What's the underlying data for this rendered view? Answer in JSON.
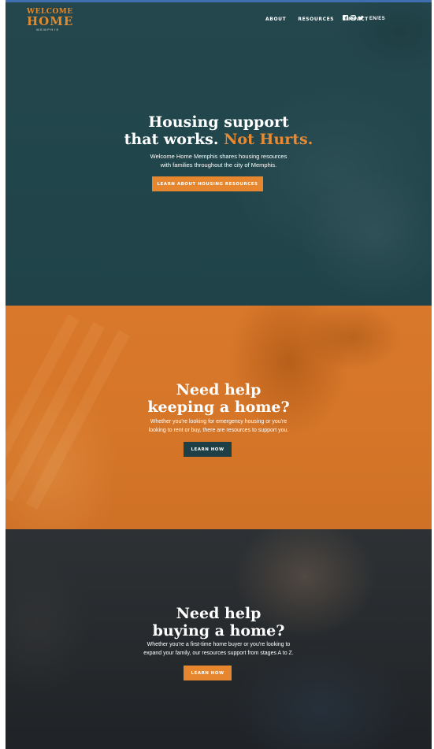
{
  "brand": {
    "logo_top": "WELCOME",
    "logo_main": "HOME",
    "logo_sub": "MEMPHIS"
  },
  "nav": {
    "about": "ABOUT",
    "resources": "RESOURCES",
    "impact": "IMPACT",
    "language": "EN/ES"
  },
  "social_icons": [
    "facebook-icon",
    "instagram-icon",
    "twitter-icon"
  ],
  "colors": {
    "teal": "#214449",
    "orange": "#e6872f",
    "dark_teal_button": "#1d3f45",
    "charcoal": "#26292c"
  },
  "hero": {
    "title_line1": "Housing support",
    "title_line2_plain": "that works.",
    "title_line2_accent": "Not Hurts.",
    "subtitle_line1": "Welcome Home Memphis shares housing resources",
    "subtitle_line2": "with families throughout the city of Memphis.",
    "button": "LEARN ABOUT HOUSING RESOURCES"
  },
  "keep_section": {
    "title_line1": "Need help",
    "title_line2": "keeping a home?",
    "subtitle_line1": "Whether you're looking for emergency housing or you're",
    "subtitle_line2": "looking to rent or buy, there are resources to support you.",
    "button": "LEARN HOW"
  },
  "buy_section": {
    "title_line1": "Need help",
    "title_line2": "buying a home?",
    "subtitle_line1": "Whether you're a first-time home buyer or you're looking to",
    "subtitle_line2": "expand your family, our resources support from stages A to Z.",
    "button": "LEARN HOW"
  }
}
